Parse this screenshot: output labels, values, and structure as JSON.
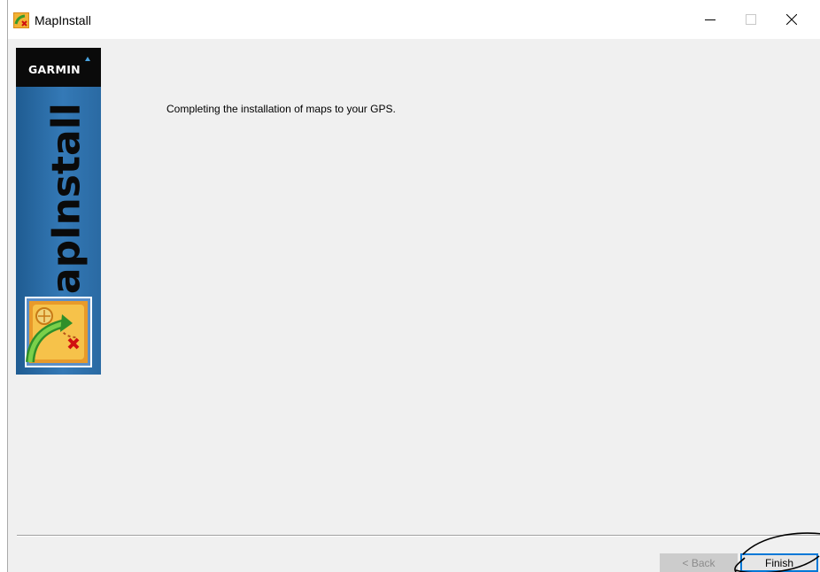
{
  "window": {
    "title": "MapInstall",
    "controls": {
      "minimize_icon": "minimize-icon",
      "maximize_icon": "maximize-icon",
      "close_icon": "close-icon"
    }
  },
  "sidebar": {
    "brand": "GARMIN",
    "brand_mark": ".",
    "vertical_label": "MapInstall",
    "icon": "map-install-icon",
    "background_color": "#2d6ea7"
  },
  "main": {
    "message": "Completing the installation of maps to your GPS."
  },
  "footer": {
    "back_label": "< Back",
    "finish_label": "Finish",
    "back_enabled": false
  },
  "colors": {
    "accent": "#0078d7",
    "dialog_bg": "#f0f0f0"
  }
}
